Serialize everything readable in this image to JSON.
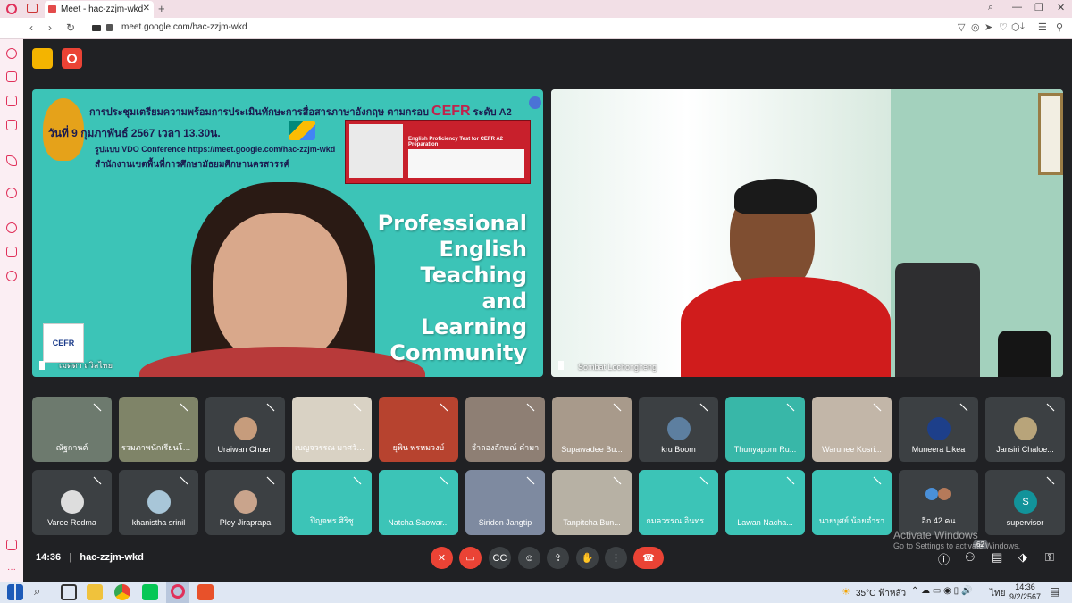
{
  "browser": {
    "tab_title": "Meet - hac-zzjm-wkd",
    "url": "meet.google.com/hac-zzjm-wkd"
  },
  "main_video_left": {
    "slide_title": "การประชุมเตรียมความพร้อมการประเมินทักษะการสื่อสารภาษาอังกฤษ ตามกรอบ",
    "slide_title_cefr": "CEFR",
    "slide_title_level": "ระดับ A2",
    "slide_date": "วันที่ 9 กุมภาพันธ์ 2567 เวลา 13.30น.",
    "slide_format": "รูปแบบ VDO Conference https://meet.google.com/hac-zzjm-wkd",
    "slide_org": "สำนักงานเขตพื้นที่การศึกษามัธยมศึกษานครสวรรค์",
    "poster_title": "English Proficiency Test for CEFR A2 Preparation",
    "pel_lines": [
      "Professional",
      "English",
      "Teaching",
      "and",
      "Learning",
      "Community"
    ],
    "cefr_logo": "CEFR",
    "participant_name": "เมตตา ถวิลไทย"
  },
  "main_video_right": {
    "participant_name": "Sombat Lochongheng"
  },
  "participants_row1": [
    {
      "name": "ณัฐกานต์"
    },
    {
      "name": "รวมภาพนักเรียนโครงการ"
    },
    {
      "name": "Uraiwan Chuen"
    },
    {
      "name": "เบญจวรรณ มาศวัฒน์"
    },
    {
      "name": "ยุพิน พรหมวงษ์"
    },
    {
      "name": "จำลองลักษณ์ คำมา"
    },
    {
      "name": "Supawadee Bu..."
    },
    {
      "name": "kru Boom"
    },
    {
      "name": "Thunyaporn Ru..."
    },
    {
      "name": "Warunee Kosri..."
    },
    {
      "name": "Muneera Likea"
    },
    {
      "name": "Jansiri Chaloe..."
    }
  ],
  "participants_row2": [
    {
      "name": "Varee Rodma"
    },
    {
      "name": "khanistha srinil"
    },
    {
      "name": "Ploy Jiraprapa"
    },
    {
      "name": "ปิญจพร ศิริชู"
    },
    {
      "name": "Natcha Saowar..."
    },
    {
      "name": "Siridon Jangtip"
    },
    {
      "name": "Tanpitcha Bun..."
    },
    {
      "name": "กมลวรรณ อินทร..."
    },
    {
      "name": "Lawan Nacha..."
    },
    {
      "name": "นายบุศย์ น้อยตำรา"
    },
    {
      "name": "อีก 42 คน"
    },
    {
      "name": "supervisor",
      "initial": "S"
    }
  ],
  "bottom_bar": {
    "time": "14:36",
    "meeting_code": "hac-zzjm-wkd",
    "people_count": "62"
  },
  "watermark": {
    "line1": "Activate Windows",
    "line2": "Go to Settings to activate Windows."
  },
  "taskbar": {
    "weather": "35°C ฟ้าหลัว",
    "clock_time": "14:36",
    "clock_date": "9/2/2567",
    "lang": "ไทย"
  },
  "colors": {
    "meet_bg": "#202124",
    "tile_bg": "#3c4043",
    "end_call": "#ea4335",
    "slide_teal": "#3cc4b7",
    "browser_pink": "#f2dfe6"
  }
}
